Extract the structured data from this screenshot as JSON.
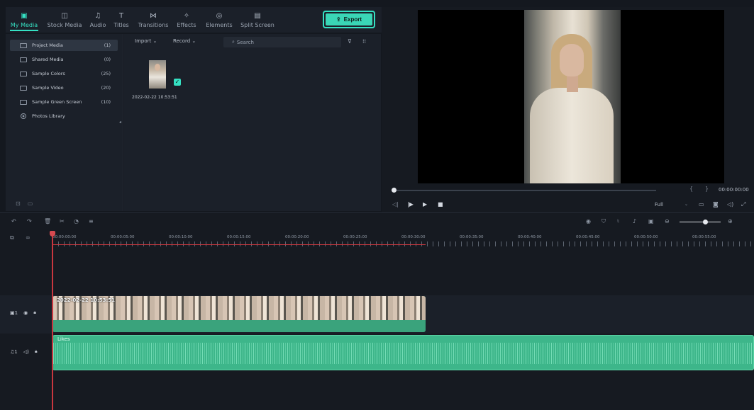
{
  "tabs": [
    {
      "label": "My Media",
      "icon": "media-icon",
      "glyph": "▣",
      "active": true
    },
    {
      "label": "Stock Media",
      "icon": "stock-media-icon",
      "glyph": "◫",
      "active": false
    },
    {
      "label": "Audio",
      "icon": "audio-icon",
      "glyph": "♫",
      "active": false
    },
    {
      "label": "Titles",
      "icon": "titles-icon",
      "glyph": "T",
      "active": false
    },
    {
      "label": "Transitions",
      "icon": "transitions-icon",
      "glyph": "⋈",
      "active": false
    },
    {
      "label": "Effects",
      "icon": "effects-icon",
      "glyph": "✧",
      "active": false
    },
    {
      "label": "Elements",
      "icon": "elements-icon",
      "glyph": "◎",
      "active": false
    },
    {
      "label": "Split Screen",
      "icon": "split-screen-icon",
      "glyph": "▤",
      "active": false
    }
  ],
  "export": {
    "label": "Export",
    "icon": "export-icon"
  },
  "sidebar": {
    "items": [
      {
        "label": "Project Media",
        "count": "(1)",
        "active": true
      },
      {
        "label": "Shared Media",
        "count": "(0)",
        "active": false
      },
      {
        "label": "Sample Colors",
        "count": "(25)",
        "active": false
      },
      {
        "label": "Sample Video",
        "count": "(20)",
        "active": false
      },
      {
        "label": "Sample Green Screen",
        "count": "(10)",
        "active": false
      },
      {
        "label": "Photos Library",
        "count": "",
        "active": false
      }
    ]
  },
  "media": {
    "import_label": "Import ⌄",
    "record_label": "Record ⌄",
    "search_placeholder": "Search",
    "item_date": "2022-02-22 10:53:51"
  },
  "preview": {
    "timecode": "00:00:00:00",
    "zoom": "Full",
    "progress": 0.0
  },
  "timeline": {
    "ticks": [
      "00:00:00:00",
      "00:00:05:00",
      "00:00:10:00",
      "00:00:15:00",
      "00:00:20:00",
      "00:00:25:00",
      "00:00:30:00",
      "00:00:35:00",
      "00:00:40:00",
      "00:00:45:00",
      "00:00:50:00",
      "00:00:55:00"
    ],
    "video_clip_title": "2022-02-22 10:53:51",
    "audio_clip_title": "Likes",
    "video_track_label": "1",
    "audio_track_label": "1"
  }
}
